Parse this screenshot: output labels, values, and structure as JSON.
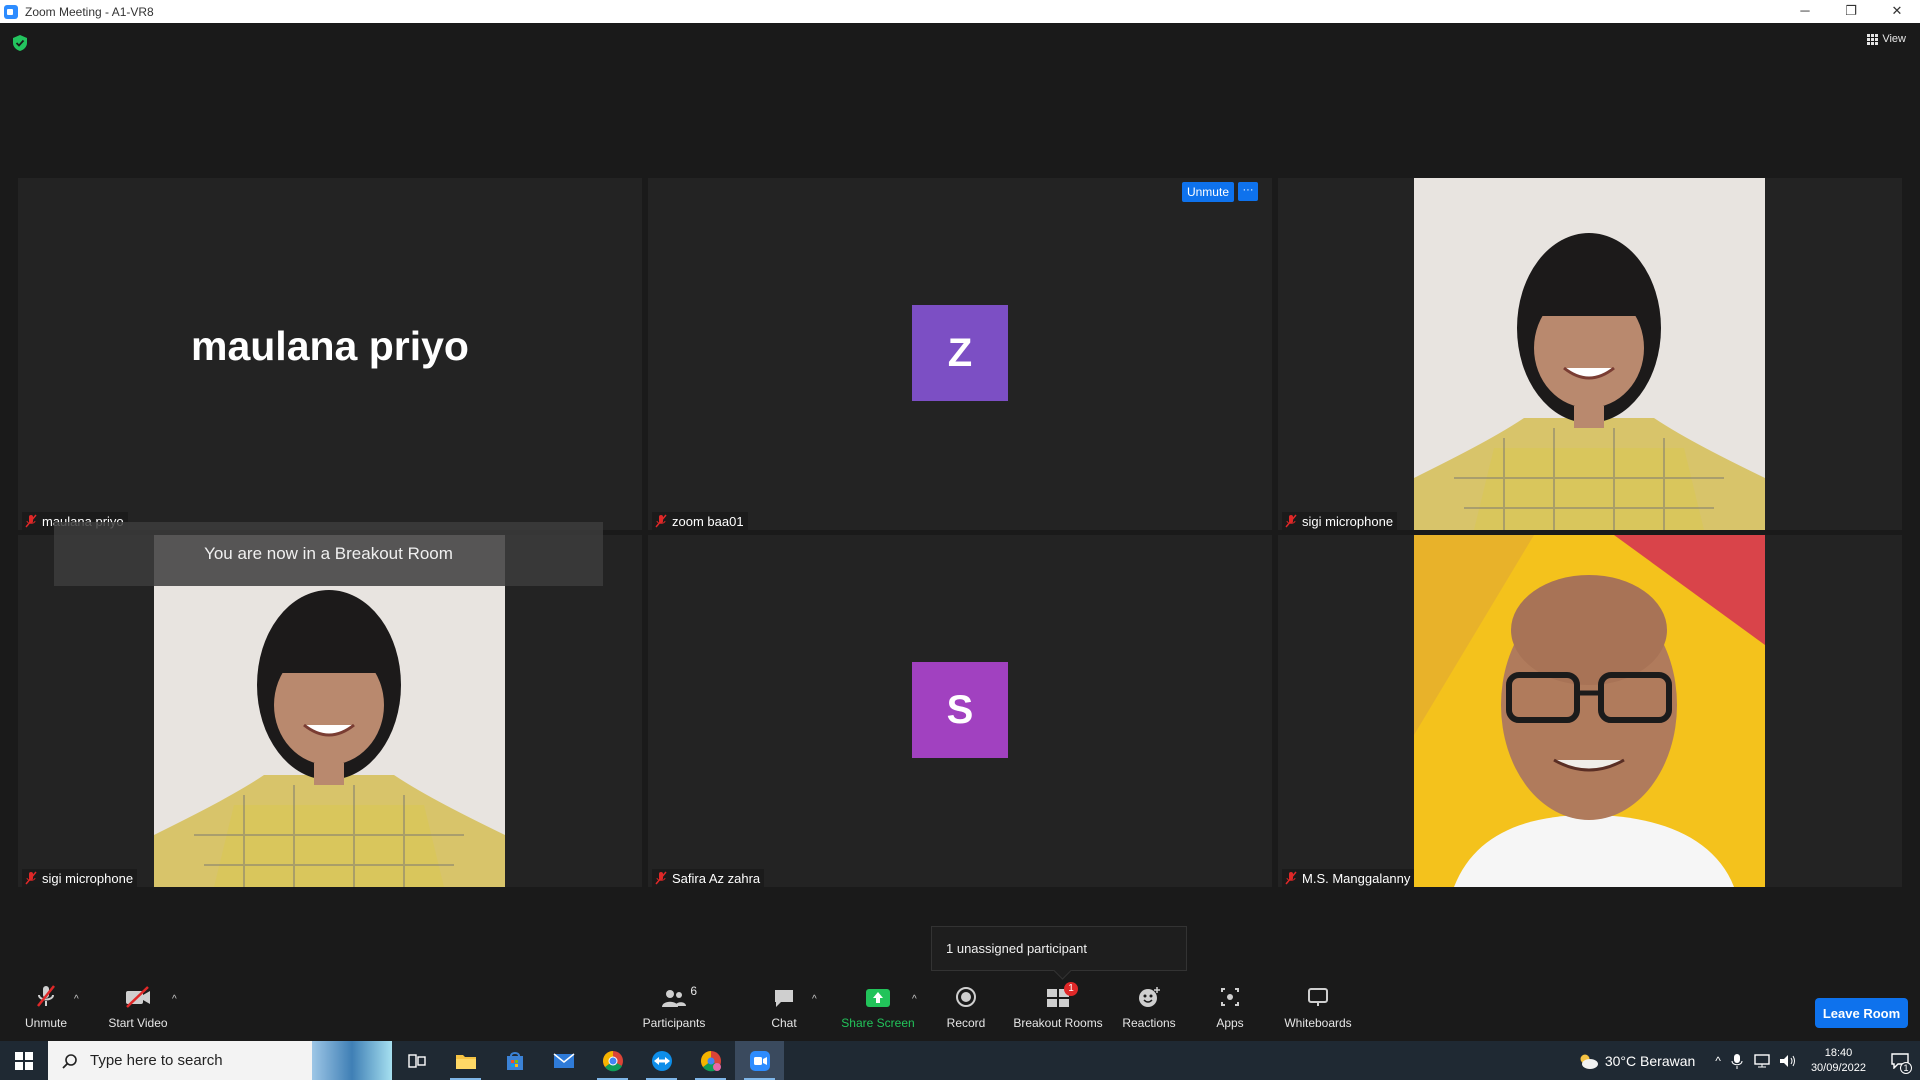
{
  "window": {
    "title": "Zoom Meeting - A1-VR8",
    "controls": [
      "─",
      "❐",
      "✕"
    ]
  },
  "header": {
    "view_label": "View"
  },
  "tiles": [
    {
      "name": "maulana priyo",
      "big_name": "maulana priyo",
      "kind": "name"
    },
    {
      "name": "zoom baa01",
      "avatar_letter": "Z",
      "avatar_color": "#7c4fc4",
      "kind": "avatar"
    },
    {
      "name": "sigi microphone",
      "kind": "video"
    },
    {
      "name": "sigi microphone",
      "kind": "video"
    },
    {
      "name": "Safira Az zahra",
      "avatar_letter": "S",
      "avatar_color": "#a141c0",
      "kind": "avatar"
    },
    {
      "name": "M.S. Manggalanny",
      "kind": "video"
    }
  ],
  "tile_actions": {
    "unmute_label": "Unmute",
    "more_label": "···"
  },
  "banner": {
    "text": "You are now in a Breakout Room"
  },
  "tooltip": {
    "text": "1 unassigned participant"
  },
  "toolbar": {
    "unmute": "Unmute",
    "start_video": "Start Video",
    "participants": "Participants",
    "participant_count": "6",
    "chat": "Chat",
    "share_screen": "Share Screen",
    "record": "Record",
    "breakout_rooms": "Breakout Rooms",
    "breakout_badge": "1",
    "reactions": "Reactions",
    "apps": "Apps",
    "whiteboards": "Whiteboards",
    "leave_room": "Leave Room"
  },
  "taskbar": {
    "search_placeholder": "Type here to search",
    "weather": "30°C  Berawan",
    "time": "18:40",
    "date": "30/09/2022",
    "notification_count": "1"
  },
  "colors": {
    "accent": "#0e72ed",
    "share_green": "#22c35a",
    "badge_red": "#e02828",
    "mic_muted_red": "#e02828"
  }
}
